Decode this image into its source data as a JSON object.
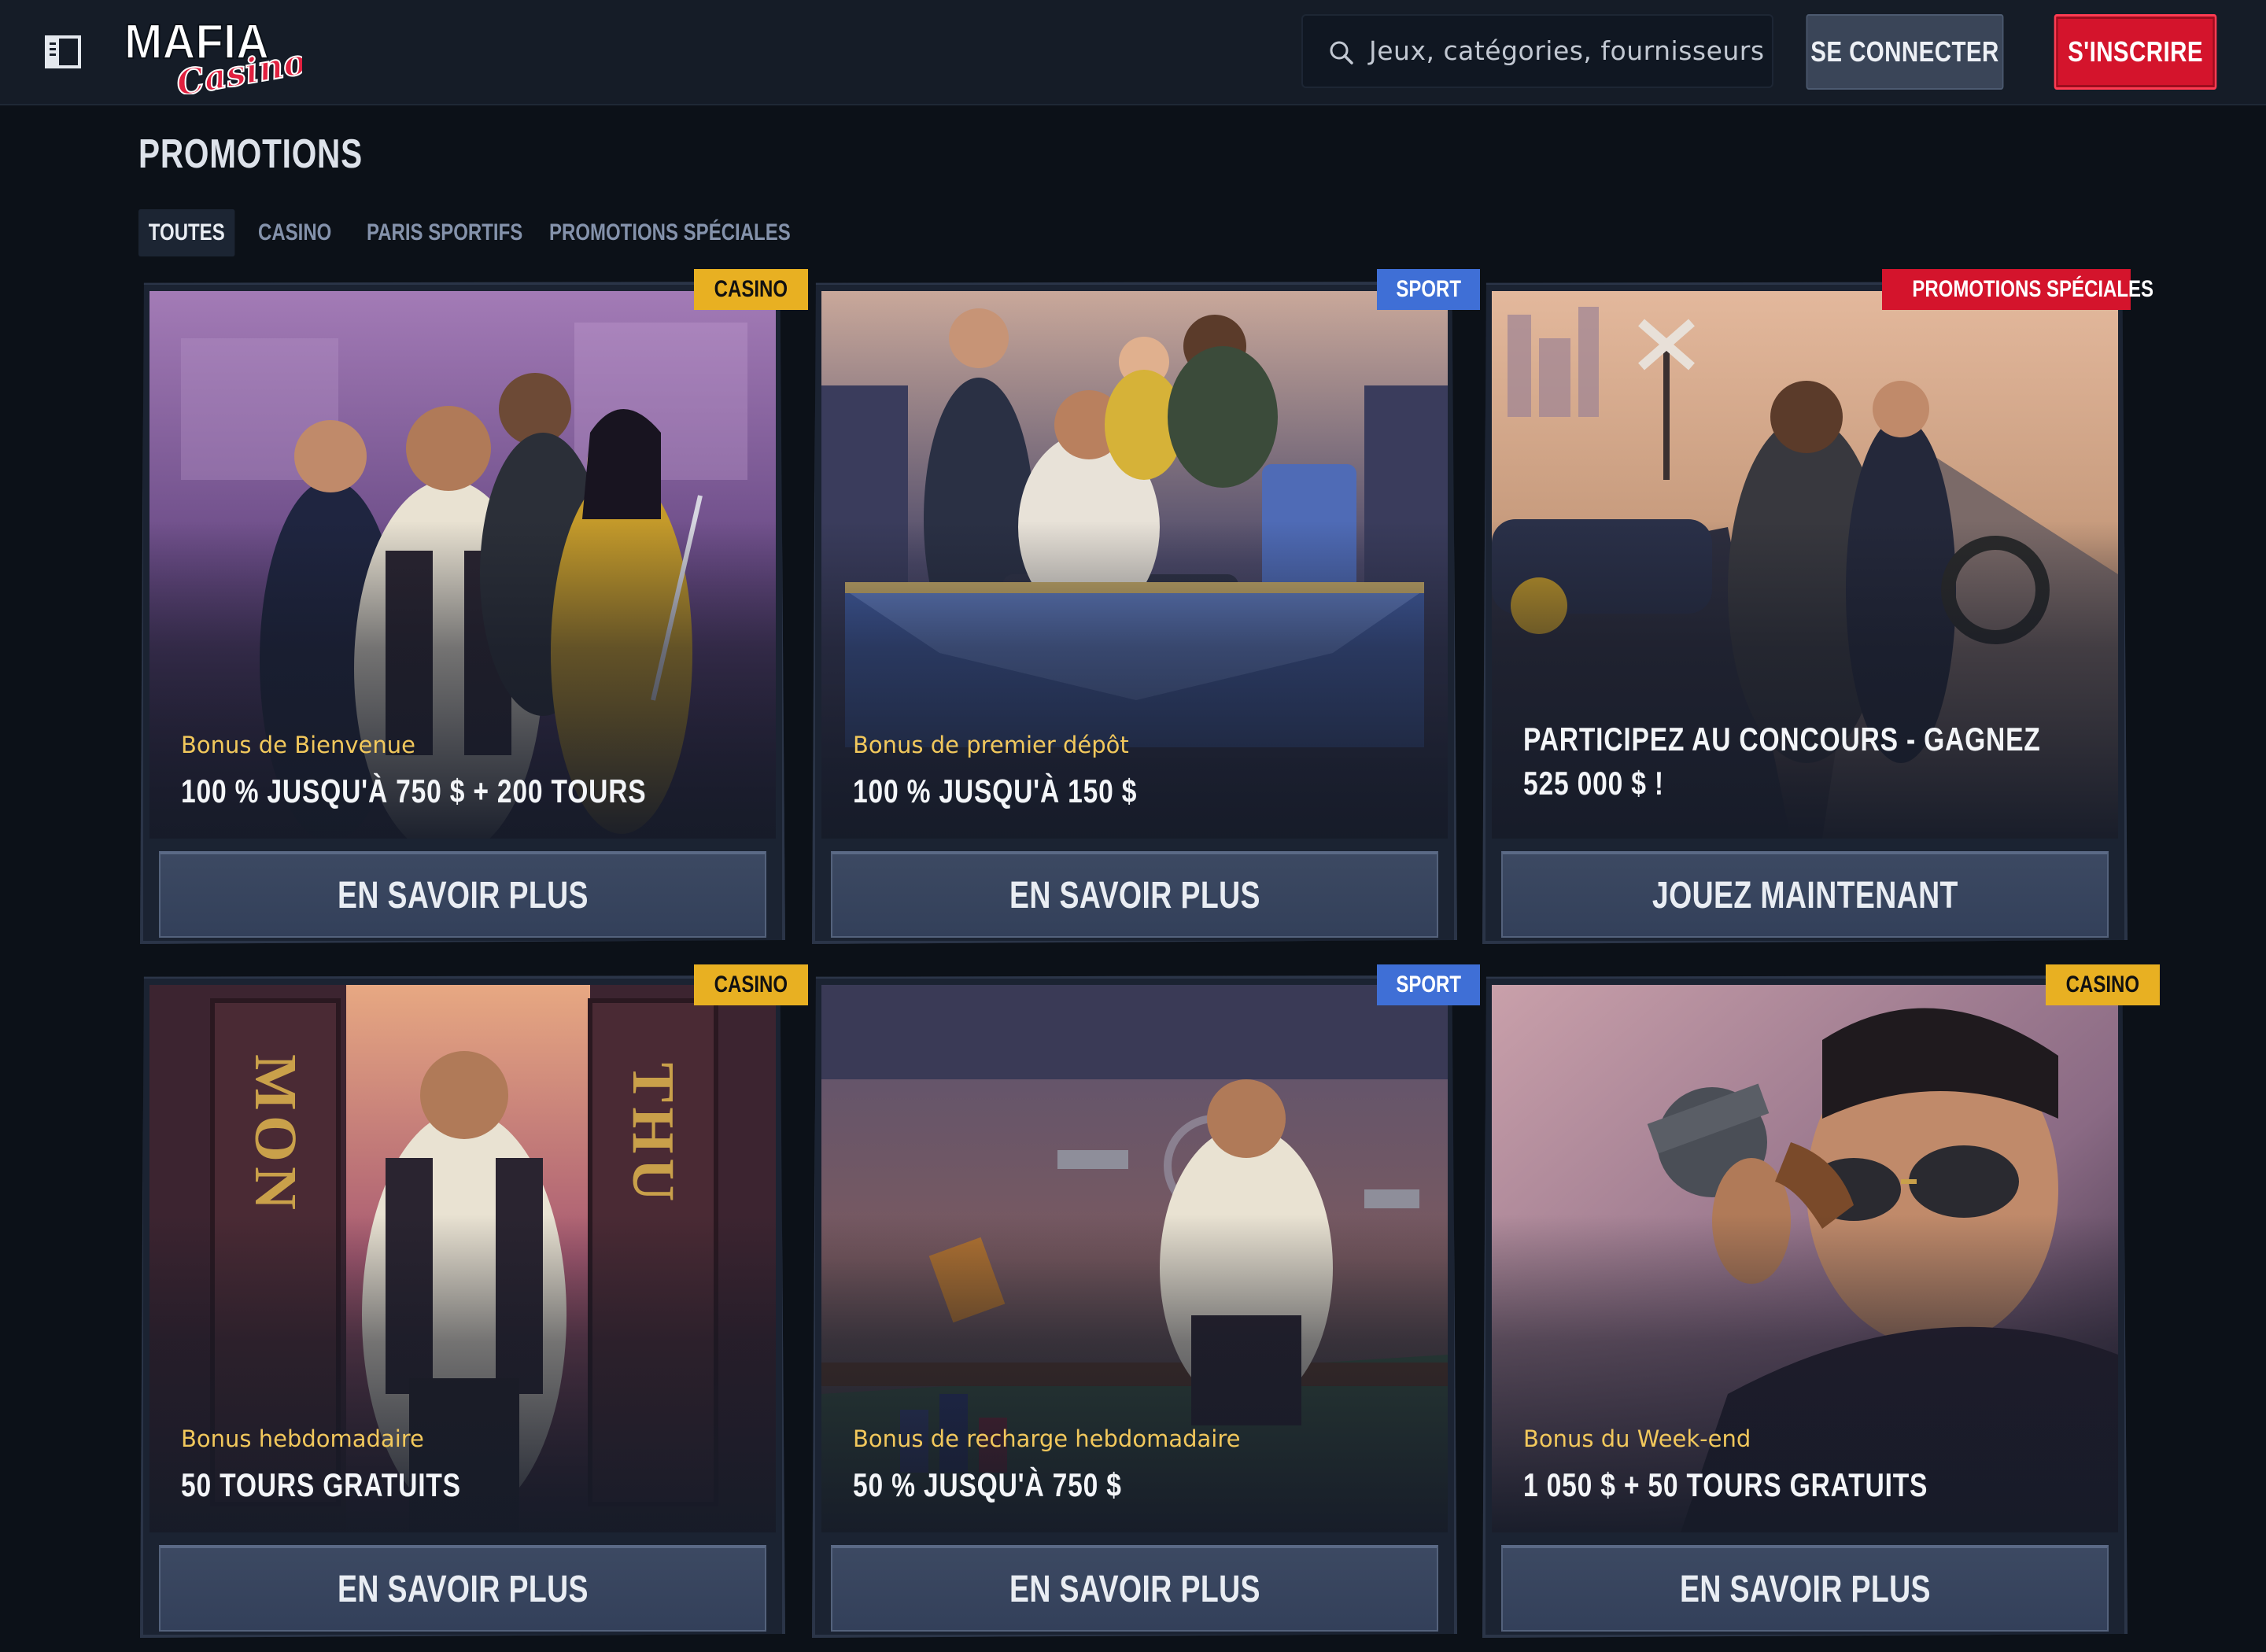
{
  "header": {
    "logo_text": "MAFIA",
    "logo_script": "Casino",
    "search_placeholder": "Jeux, catégories, fournisseurs",
    "login_label": "SE CONNECTER",
    "register_label": "S'INSCRIRE"
  },
  "page": {
    "title": "PROMOTIONS"
  },
  "tabs": [
    {
      "label": "TOUTES",
      "active": true
    },
    {
      "label": "CASINO",
      "active": false
    },
    {
      "label": "PARIS SPORTIFS",
      "active": false
    },
    {
      "label": "PROMOTIONS SPÉCIALES",
      "active": false
    }
  ],
  "cards": [
    {
      "badge": "CASINO",
      "badge_type": "casino",
      "subtitle": "Bonus de Bienvenue",
      "headline": "100 % JUSQU'À 750 $ + 200 TOURS",
      "cta": "EN SAVOIR PLUS"
    },
    {
      "badge": "SPORT",
      "badge_type": "sport",
      "subtitle": "Bonus de premier dépôt",
      "headline": "100 % JUSQU'À 150 $",
      "cta": "EN SAVOIR PLUS"
    },
    {
      "badge": "PROMOTIONS SPÉCIALES",
      "badge_type": "special",
      "subtitle": "",
      "headline": "PARTICIPEZ AU CONCOURS - GAGNEZ 525 000 $ !",
      "cta": "JOUEZ MAINTENANT"
    },
    {
      "badge": "CASINO",
      "badge_type": "casino",
      "subtitle": "Bonus hebdomadaire",
      "headline": "50 TOURS GRATUITS",
      "cta": "EN SAVOIR PLUS"
    },
    {
      "badge": "SPORT",
      "badge_type": "sport",
      "subtitle": "Bonus de recharge hebdomadaire",
      "headline": "50 % JUSQU'À 750 $",
      "cta": "EN SAVOIR PLUS"
    },
    {
      "badge": "CASINO",
      "badge_type": "casino",
      "subtitle": "Bonus du Week-end",
      "headline": "1 050 $ + 50 TOURS GRATUITS",
      "cta": "EN SAVOIR PLUS"
    }
  ],
  "art_labels": {
    "door_left": "MON",
    "door_right": "THU"
  },
  "colors": {
    "background": "#0c1118",
    "topbar": "#151c27",
    "register": "#d4142c",
    "casino_badge": "#e8b022",
    "sport_badge": "#3f6fd6",
    "special_badge": "#d4142c",
    "subtitle": "#f2c85c"
  }
}
